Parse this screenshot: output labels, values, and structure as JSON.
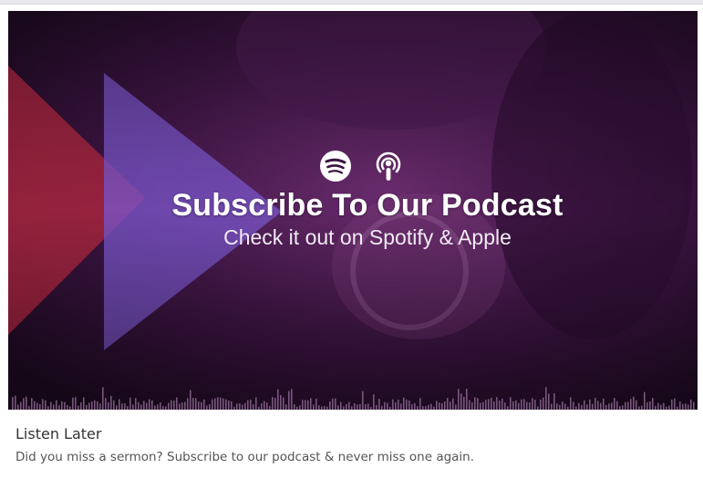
{
  "banner": {
    "icons": [
      "spotify-icon",
      "apple-podcasts-icon"
    ],
    "title": "Subscribe To Our Podcast",
    "subtitle": "Check it out on Spotify & Apple"
  },
  "caption": {
    "title": "Listen Later",
    "text": "Did you miss a sermon? Subscribe to our podcast & never miss one again."
  },
  "colors": {
    "background_purple": "#3a1440",
    "accent_red": "#a3243f",
    "accent_violet": "#7a55c8",
    "text_white": "#ffffff"
  }
}
